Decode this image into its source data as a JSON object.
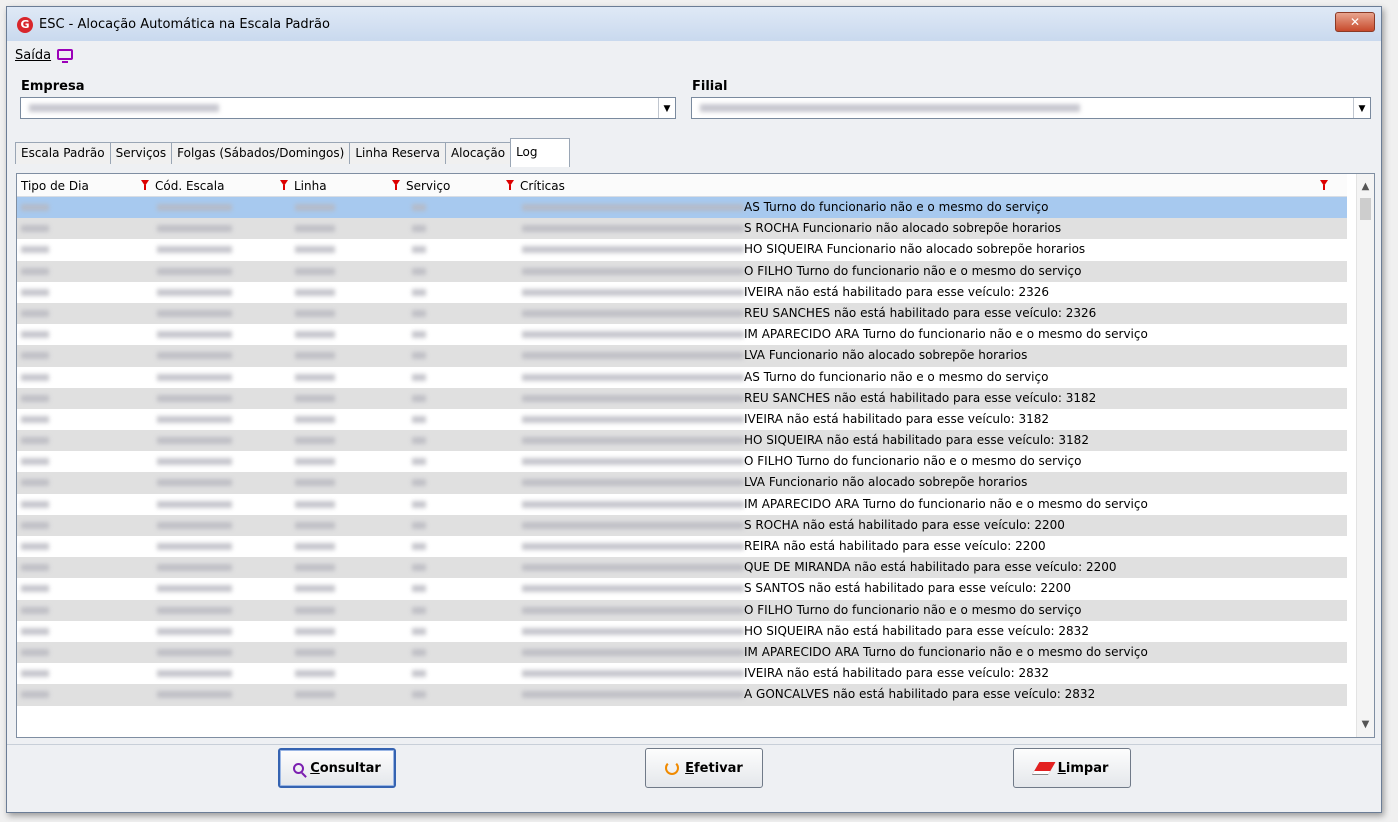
{
  "window": {
    "title": "ESC - Alocação Automática na Escala Padrão",
    "logo": "G",
    "close": "✕"
  },
  "menu": {
    "exit": "Saída",
    "monitor_icon": "monitor-icon"
  },
  "fields": {
    "empresa_label": "Empresa",
    "filial_label": "Filial"
  },
  "tabs": [
    {
      "label": "Escala Padrão"
    },
    {
      "label": "Serviços"
    },
    {
      "label": "Folgas (Sábados/Domingos)"
    },
    {
      "label": "Linha Reserva"
    },
    {
      "label": "Alocação"
    },
    {
      "label": "Log",
      "active": true
    }
  ],
  "grid": {
    "columns": [
      "Tipo de Dia",
      "Cód. Escala",
      "Linha",
      "Serviço",
      "Críticas"
    ],
    "rows": [
      "AS  Turno do funcionario não e o mesmo do serviço",
      "S ROCHA  Funcionario não alocado sobrepõe horarios",
      "HO SIQUEIRA  Funcionario não alocado sobrepõe horarios",
      "O FILHO  Turno do funcionario não e o mesmo do serviço",
      "IVEIRA não está habilitado para esse veículo: 2326",
      "REU SANCHES não está habilitado para esse veículo: 2326",
      "IM APARECIDO ARA  Turno do funcionario não e o mesmo do serviço",
      "LVA  Funcionario não alocado sobrepõe horarios",
      "AS  Turno do funcionario não e o mesmo do serviço",
      "REU SANCHES não está habilitado para esse veículo: 3182",
      "IVEIRA não está habilitado para esse veículo: 3182",
      "HO SIQUEIRA não está habilitado para esse veículo: 3182",
      "O FILHO  Turno do funcionario não e o mesmo do serviço",
      "LVA  Funcionario não alocado sobrepõe horarios",
      "IM APARECIDO ARA  Turno do funcionario não e o mesmo do serviço",
      "S ROCHA não está habilitado para esse veículo: 2200",
      "REIRA não está habilitado para esse veículo: 2200",
      "QUE DE MIRANDA não está habilitado para esse veículo: 2200",
      "S SANTOS não está habilitado para esse veículo: 2200",
      "O FILHO  Turno do funcionario não e o mesmo do serviço",
      "HO SIQUEIRA não está habilitado para esse veículo: 2832",
      "IM APARECIDO ARA  Turno do funcionario não e o mesmo do serviço",
      "IVEIRA não está habilitado para esse veículo: 2832",
      "A GONCALVES não está habilitado para esse veículo: 2832"
    ]
  },
  "buttons": {
    "consultar": {
      "first": "C",
      "rest": "onsultar"
    },
    "efetivar": {
      "first": "E",
      "rest": "fetivar"
    },
    "limpar": {
      "first": "L",
      "rest": "impar"
    }
  }
}
